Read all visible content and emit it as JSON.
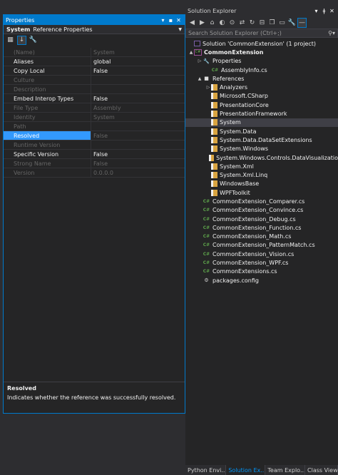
{
  "properties": {
    "title": "Properties",
    "selector_name": "System",
    "selector_type": "Reference Properties",
    "rows": [
      {
        "name": "(Name)",
        "value": "System",
        "dim": true
      },
      {
        "name": "Aliases",
        "value": "global",
        "dim": false
      },
      {
        "name": "Copy Local",
        "value": "False",
        "dim": false
      },
      {
        "name": "Culture",
        "value": "",
        "dim": true
      },
      {
        "name": "Description",
        "value": "",
        "dim": true
      },
      {
        "name": "Embed Interop Types",
        "value": "False",
        "dim": false
      },
      {
        "name": "File Type",
        "value": "Assembly",
        "dim": true
      },
      {
        "name": "Identity",
        "value": "System",
        "dim": true
      },
      {
        "name": "Path",
        "value": "",
        "dim": true
      },
      {
        "name": "Resolved",
        "value": "False",
        "dim": true,
        "selected": true
      },
      {
        "name": "Runtime Version",
        "value": "",
        "dim": true
      },
      {
        "name": "Specific Version",
        "value": "False",
        "dim": false
      },
      {
        "name": "Strong Name",
        "value": "False",
        "dim": true
      },
      {
        "name": "Version",
        "value": "0.0.0.0",
        "dim": true
      }
    ],
    "desc_title": "Resolved",
    "desc_text": "Indicates whether the reference was successfully resolved."
  },
  "solution": {
    "title": "Solution Explorer",
    "search_placeholder": "Search Solution Explorer (Ctrl+;)",
    "nodes": [
      {
        "label": "Solution 'CommonExtension' (1 project)",
        "indent": 0,
        "icon": "sln",
        "exp": ""
      },
      {
        "label": "CommonExtension",
        "indent": 0,
        "icon": "proj",
        "exp": "▲",
        "bold": true
      },
      {
        "label": "Properties",
        "indent": 1,
        "icon": "wrench",
        "exp": "▷"
      },
      {
        "label": "AssemblyInfo.cs",
        "indent": 2,
        "icon": "cs",
        "exp": ""
      },
      {
        "label": "References",
        "indent": 1,
        "icon": "refs",
        "exp": "▲"
      },
      {
        "label": "Analyzers",
        "indent": 2,
        "icon": "ref",
        "exp": "▷"
      },
      {
        "label": "Microsoft.CSharp",
        "indent": 2,
        "icon": "ref",
        "exp": ""
      },
      {
        "label": "PresentationCore",
        "indent": 2,
        "icon": "ref",
        "exp": ""
      },
      {
        "label": "PresentationFramework",
        "indent": 2,
        "icon": "ref",
        "exp": ""
      },
      {
        "label": "System",
        "indent": 2,
        "icon": "ref",
        "exp": "",
        "selected": true
      },
      {
        "label": "System.Data",
        "indent": 2,
        "icon": "ref",
        "exp": ""
      },
      {
        "label": "System.Data.DataSetExtensions",
        "indent": 2,
        "icon": "ref",
        "exp": ""
      },
      {
        "label": "System.Windows",
        "indent": 2,
        "icon": "ref",
        "exp": ""
      },
      {
        "label": "System.Windows.Controls.DataVisualizatio",
        "indent": 2,
        "icon": "ref",
        "exp": ""
      },
      {
        "label": "System.Xml",
        "indent": 2,
        "icon": "ref",
        "exp": ""
      },
      {
        "label": "System.Xml.Linq",
        "indent": 2,
        "icon": "ref",
        "exp": ""
      },
      {
        "label": "WindowsBase",
        "indent": 2,
        "icon": "ref",
        "exp": ""
      },
      {
        "label": "WPFToolkit",
        "indent": 2,
        "icon": "ref",
        "exp": ""
      },
      {
        "label": "CommonExtension_Comparer.cs",
        "indent": 1,
        "icon": "cs",
        "exp": ""
      },
      {
        "label": "CommonExtension_Convince.cs",
        "indent": 1,
        "icon": "cs",
        "exp": ""
      },
      {
        "label": "CommonExtension_Debug.cs",
        "indent": 1,
        "icon": "cs",
        "exp": ""
      },
      {
        "label": "CommonExtension_Function.cs",
        "indent": 1,
        "icon": "cs",
        "exp": ""
      },
      {
        "label": "CommonExtension_Math.cs",
        "indent": 1,
        "icon": "cs",
        "exp": ""
      },
      {
        "label": "CommonExtension_PatternMatch.cs",
        "indent": 1,
        "icon": "cs",
        "exp": ""
      },
      {
        "label": "CommonExtension_Vision.cs",
        "indent": 1,
        "icon": "cs",
        "exp": ""
      },
      {
        "label": "CommonExtension_WPF.cs",
        "indent": 1,
        "icon": "cs",
        "exp": ""
      },
      {
        "label": "CommonExtensions.cs",
        "indent": 1,
        "icon": "cs",
        "exp": ""
      },
      {
        "label": "packages.config",
        "indent": 1,
        "icon": "cfg",
        "exp": ""
      }
    ]
  },
  "tabs": [
    "Python Envi...",
    "Solution Ex...",
    "Team Explo...",
    "Class View"
  ]
}
